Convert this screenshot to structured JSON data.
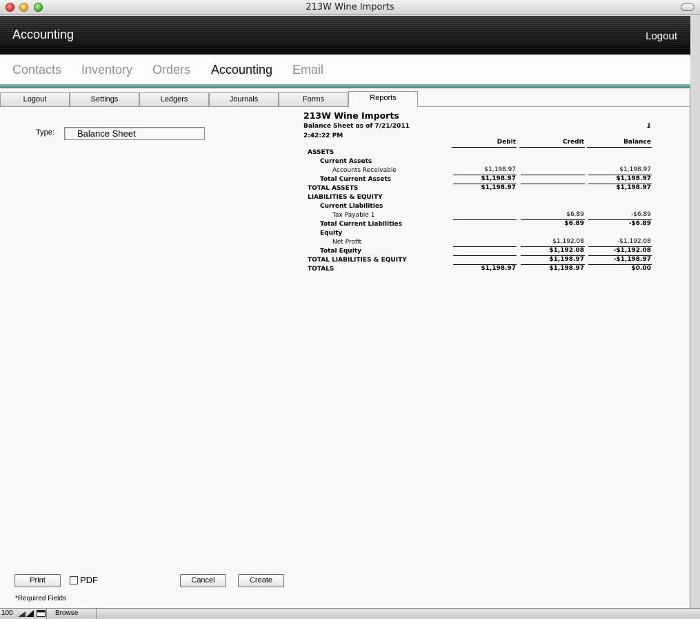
{
  "window": {
    "title": "213W Wine Imports"
  },
  "header": {
    "title": "Accounting",
    "logout": "Logout"
  },
  "modules": [
    "Contacts",
    "Inventory",
    "Orders",
    "Accounting",
    "Email"
  ],
  "active_module": "Accounting",
  "tabs": [
    "Logout",
    "Settings",
    "Ledgers",
    "Journals",
    "Forms",
    "Reports"
  ],
  "active_tab": "Reports",
  "form": {
    "type_label": "Type:",
    "type_value": "Balance Sheet"
  },
  "report": {
    "company": "213W Wine Imports",
    "subtitle": "Balance Sheet as of 7/21/2011",
    "time": "2:42:22 PM",
    "page": "1",
    "columns": [
      "Debit",
      "Credit",
      "Balance"
    ],
    "rows": [
      {
        "label": "ASSETS",
        "indent": 0,
        "bold": true,
        "debit": "",
        "credit": "",
        "balance": "",
        "lines": "none"
      },
      {
        "label": "Current Assets",
        "indent": 1,
        "bold": true,
        "debit": "",
        "credit": "",
        "balance": "",
        "lines": "none"
      },
      {
        "label": "Accounts Receivable",
        "indent": 2,
        "bold": false,
        "debit": "$1,198.97",
        "credit": "",
        "balance": "$1,198.97",
        "lines": "under"
      },
      {
        "label": "Total Current Assets",
        "indent": 1,
        "bold": true,
        "debit": "$1,198.97",
        "credit": "",
        "balance": "$1,198.97",
        "lines": "under"
      },
      {
        "label": "TOTAL ASSETS",
        "indent": 0,
        "bold": true,
        "debit": "$1,198.97",
        "credit": "",
        "balance": "$1,198.97",
        "lines": "none"
      },
      {
        "label": "LIABILITIES & EQUITY",
        "indent": 0,
        "bold": true,
        "debit": "",
        "credit": "",
        "balance": "",
        "lines": "none"
      },
      {
        "label": "Current Liabilities",
        "indent": 1,
        "bold": true,
        "debit": "",
        "credit": "",
        "balance": "",
        "lines": "none"
      },
      {
        "label": "Tax Payable 1",
        "indent": 2,
        "bold": false,
        "debit": "",
        "credit": "$6.89",
        "balance": "-$6.89",
        "lines": "under"
      },
      {
        "label": "Total Current Liabilities",
        "indent": 1,
        "bold": true,
        "debit": "",
        "credit": "$6.89",
        "balance": "-$6.89",
        "lines": "none"
      },
      {
        "label": "Equity",
        "indent": 1,
        "bold": true,
        "debit": "",
        "credit": "",
        "balance": "",
        "lines": "none"
      },
      {
        "label": "Net Profit",
        "indent": 2,
        "bold": false,
        "debit": "",
        "credit": "$1,192.08",
        "balance": "-$1,192.08",
        "lines": "under"
      },
      {
        "label": "Total Equity",
        "indent": 1,
        "bold": true,
        "debit": "",
        "credit": "$1,192.08",
        "balance": "-$1,192.08",
        "lines": "under"
      },
      {
        "label": "TOTAL LIABILITIES & EQUITY",
        "indent": 0,
        "bold": true,
        "debit": "",
        "credit": "$1,198.97",
        "balance": "-$1,198.97",
        "lines": "under"
      },
      {
        "label": "TOTALS",
        "indent": 0,
        "bold": true,
        "debit": "$1,198.97",
        "credit": "$1,198.97",
        "balance": "$0.00",
        "lines": "none"
      }
    ]
  },
  "buttons": {
    "print": "Print",
    "pdf": "PDF",
    "cancel": "Cancel",
    "create": "Create"
  },
  "pdf_checked": false,
  "required_note": "*Required Fields",
  "statusbar": {
    "zoom": "100",
    "mode": "Browse"
  }
}
